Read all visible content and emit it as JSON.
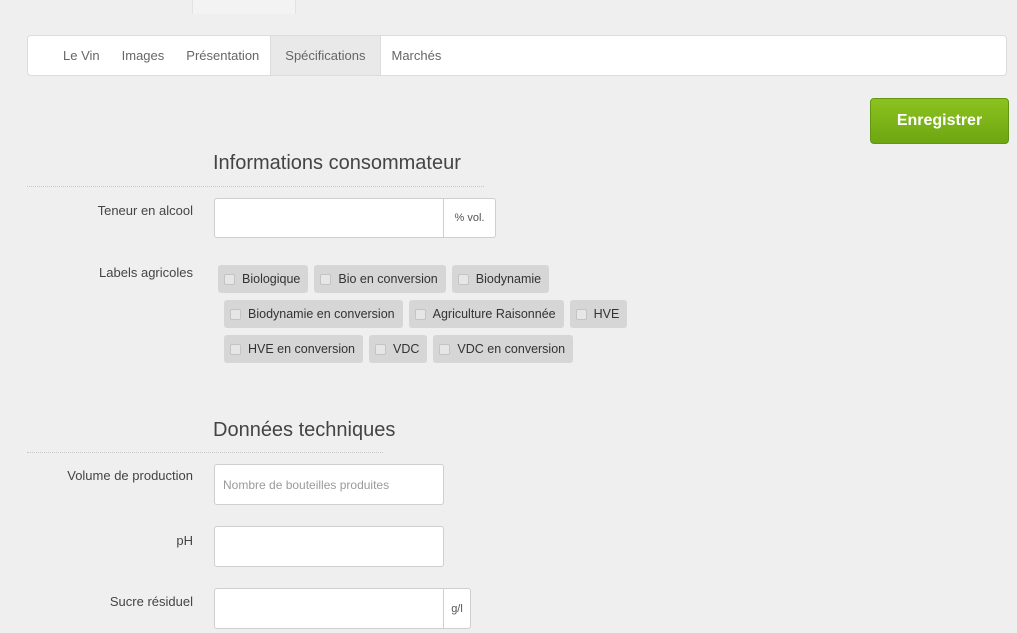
{
  "tabs": [
    {
      "label": "Le Vin",
      "active": false
    },
    {
      "label": "Images",
      "active": false
    },
    {
      "label": "Présentation",
      "active": false
    },
    {
      "label": "Spécifications",
      "active": true
    },
    {
      "label": "Marchés",
      "active": false
    }
  ],
  "save_label": "Enregistrer",
  "colors": {
    "save_button": "#7ab519",
    "chip_bg": "#d6d6d6"
  },
  "consumer": {
    "title": "Informations consommateur",
    "alcohol": {
      "label": "Teneur en alcool",
      "value": "",
      "unit": "% vol."
    },
    "labels_field": "Labels agricoles",
    "labels": [
      [
        "Biologique",
        "Bio en conversion",
        "Biodynamie"
      ],
      [
        "Biodynamie en conversion",
        "Agriculture Raisonnée",
        "HVE"
      ],
      [
        "HVE en conversion",
        "VDC",
        "VDC en conversion"
      ]
    ]
  },
  "technical": {
    "title": "Données techniques",
    "volume": {
      "label": "Volume de production",
      "placeholder": "Nombre de bouteilles produites",
      "value": ""
    },
    "ph": {
      "label": "pH",
      "value": ""
    },
    "sugar": {
      "label": "Sucre résiduel",
      "value": "",
      "unit": "g/l"
    }
  }
}
